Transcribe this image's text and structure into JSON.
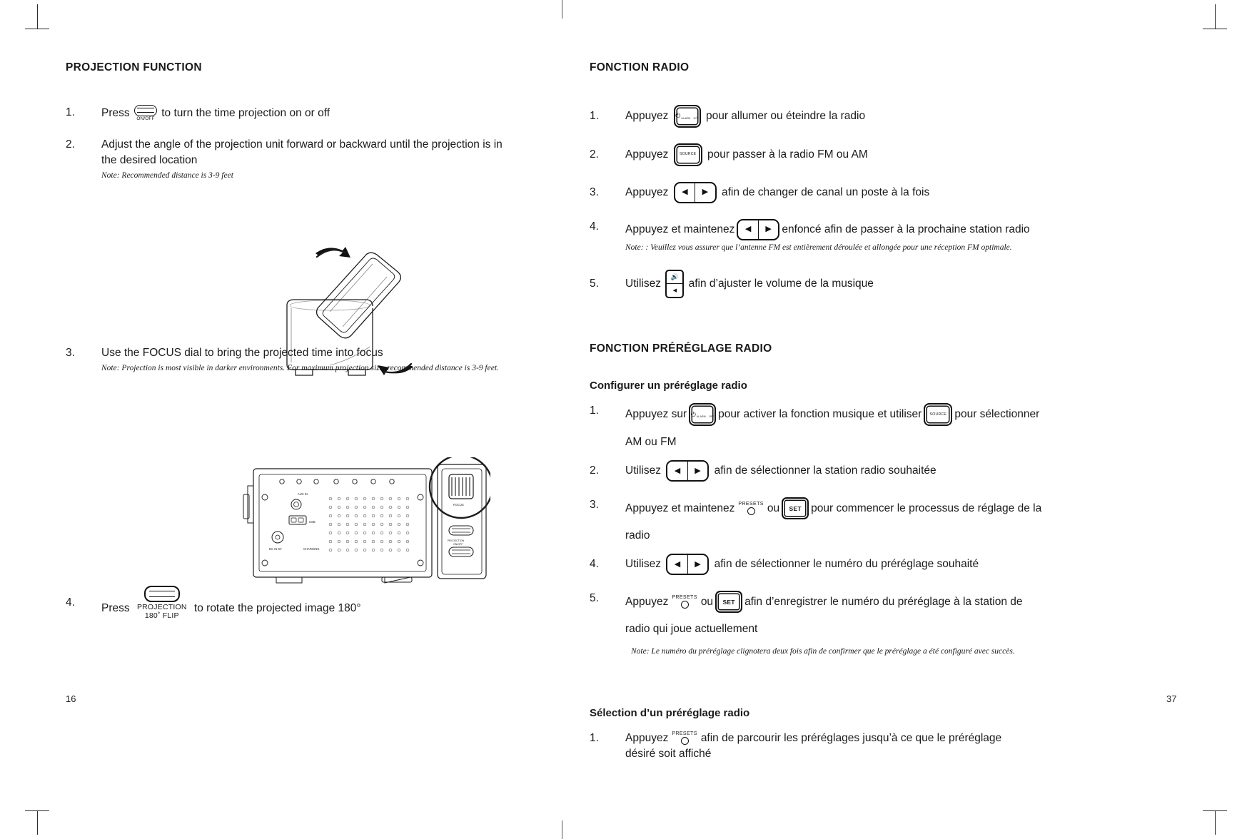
{
  "left_page": {
    "number": "16",
    "section_title": "PROJECTION FUNCTION",
    "steps": [
      {
        "num": "1.",
        "pre": "Press",
        "key": "onoff-switch",
        "post": "to turn the time projection on or off"
      },
      {
        "num": "2.",
        "text_line1": "Adjust the angle of the projection unit forward or backward until the projection is in",
        "text_line2": "the desired location",
        "note": "Note: Recommended distance is 3-9 feet"
      },
      {
        "num": "3.",
        "text_line1": "Use the FOCUS dial to bring the projected time into focus",
        "note": "Note: Projection is most visible in darker environments. For maximum projection size, recommended distance is 3-9 feet."
      },
      {
        "num": "4.",
        "pre": "Press",
        "key": "projection-180-flip-switch",
        "post": "to rotate the projected image 180°"
      }
    ],
    "keys": {
      "onoff_label": "ON/OFF",
      "flip_label_1": "PROJECTION",
      "flip_label_2": "180˚ FLIP"
    },
    "figure_labels": {
      "focus": "FOCUS",
      "aux_in": "AUX IN",
      "usb": "USB",
      "dc_in": "DC IN 5V",
      "charging": "CHARGING",
      "projection_onoff": "PROJECTION\nON/OFF"
    }
  },
  "right_page": {
    "number": "37",
    "section_title": "FONCTION RADIO",
    "radio_steps": [
      {
        "num": "1.",
        "pre": "Appuyez",
        "key": "power-alarm-off-button",
        "post": "pour allumer ou éteindre la radio"
      },
      {
        "num": "2.",
        "pre": "Appuyez",
        "key": "source-button",
        "post": "pour passer à la radio FM ou AM"
      },
      {
        "num": "3.",
        "pre": "Appuyez",
        "key": "left-right-rocker",
        "post": "afin de changer de canal un poste à la fois"
      },
      {
        "num": "4.",
        "pre": "Appuyez et maintenez",
        "key": "left-right-rocker",
        "post": "enfoncé afin de passer à la prochaine station radio",
        "note": "Note: : Veuillez vous assurer que l’antenne FM est entièrement déroulée et allongée pour une réception FM optimale."
      },
      {
        "num": "5.",
        "pre": "Utilisez",
        "key": "volume-rocker",
        "post": "afin d’ajuster le volume de la musique"
      }
    ],
    "preset_section_title": "FONCTION PRÉRÉGLAGE RADIO",
    "configure_subtitle": "Configurer un préréglage radio",
    "configure_steps": [
      {
        "num": "1.",
        "pre": "Appuyez sur",
        "key": "power-alarm-off-button",
        "mid": "pour activer la fonction musique et utiliser",
        "key2": "source-button",
        "post": "pour sélectionner",
        "line2": "AM ou FM"
      },
      {
        "num": "2.",
        "pre": "Utilisez",
        "key": "left-right-rocker",
        "post": "afin de sélectionner la station radio souhaitée"
      },
      {
        "num": "3.",
        "pre": "Appuyez et maintenez",
        "key": "presets-button",
        "mid": "ou",
        "key2": "set-button",
        "post": "pour commencer le processus de réglage de la",
        "line2": "radio"
      },
      {
        "num": "4.",
        "pre": "Utilisez",
        "key": "left-right-rocker",
        "post": "afin de sélectionner le numéro du préréglage souhaité"
      },
      {
        "num": "5.",
        "pre": "Appuyez",
        "key": "presets-button",
        "mid": "ou",
        "key2": "set-button",
        "post": "afin d’enregistrer le numéro du préréglage à la station de",
        "line2": "radio qui joue actuellement",
        "note": "Note: Le numéro du préréglage clignotera deux fois afin de confirmer que le préréglage a été configuré avec succès."
      }
    ],
    "select_subtitle": "Sélection d’un préréglage radio",
    "select_steps": [
      {
        "num": "1.",
        "pre": "Appuyez",
        "key": "presets-button",
        "post": "afin de parcourir les préréglages jusqu’à ce que le préréglage",
        "line2": "désiré soit affiché"
      }
    ],
    "keys": {
      "power_symbol": "⏻",
      "power_label_1": "ALARM",
      "power_label_2": "OFF",
      "source_label": "SOURCE",
      "set_label": "SET",
      "presets_label": "PRESETS",
      "arrow_left": "◀",
      "arrow_right": "▶",
      "volume_up": "🔊",
      "volume_down": "◀"
    }
  },
  "colors": {
    "text": "#1a1a1a",
    "line": "#2b2b2b",
    "page_bg": "#ffffff"
  }
}
